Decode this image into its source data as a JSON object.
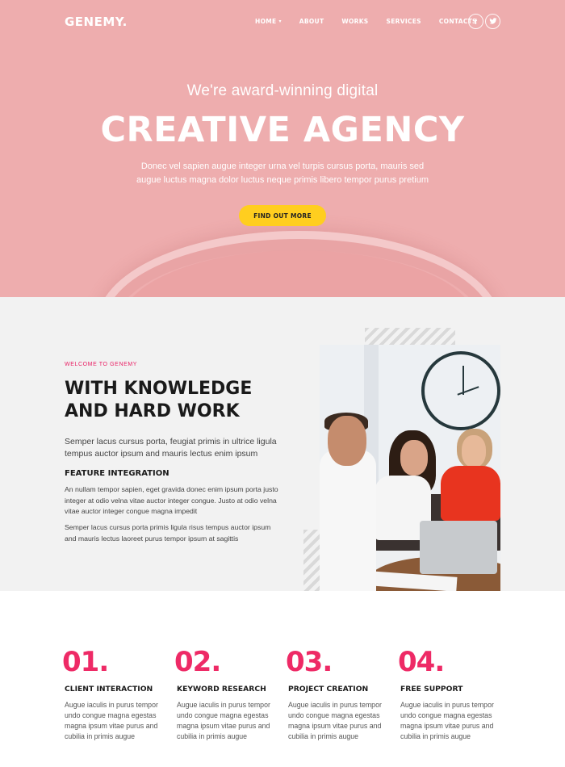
{
  "nav": {
    "logo": "GENEMY.",
    "items": [
      {
        "label": "HOME",
        "has_dropdown": true
      },
      {
        "label": "ABOUT"
      },
      {
        "label": "WORKS"
      },
      {
        "label": "SERVICES"
      },
      {
        "label": "CONTACTS"
      }
    ],
    "social": [
      {
        "icon": "facebook-icon",
        "glyph": "f"
      },
      {
        "icon": "twitter-icon",
        "glyph": "t"
      }
    ]
  },
  "hero": {
    "subtitle": "We're award-winning digital",
    "title": "CREATIVE AGENCY",
    "description": "Donec vel sapien augue integer urna vel turpis cursus porta, mauris sed augue luctus magna dolor luctus neque primis libero tempor purus pretium",
    "cta_label": "FIND OUT MORE",
    "background_color": "#eeadae",
    "cta_color": "#ffce1f"
  },
  "about": {
    "eyebrow": "WELCOME TO GENEMY",
    "title": "WITH KNOWLEDGE AND HARD WORK",
    "lead": "Semper lacus cursus porta, feugiat primis in ultrice ligula tempus auctor ipsum and mauris lectus enim ipsum",
    "feature_heading": "FEATURE INTEGRATION",
    "feature_text": "An nullam tempor sapien, eget gravida donec enim ipsum porta justo integer at odio velna vitae auctor integer congue. Justo at odio velna vitae auctor integer congue magna impedit",
    "feature_text_2": "Semper lacus cursus porta primis ligula risus tempus auctor ipsum and mauris lectus laoreet purus tempor ipsum at sagittis",
    "accent_color": "#e91e63"
  },
  "features": [
    {
      "number": "01.",
      "title": "CLIENT INTERACTION",
      "text": "Augue iaculis in purus tempor undo congue magna egestas magna ipsum vitae purus and cubilia in primis augue"
    },
    {
      "number": "02.",
      "title": "KEYWORD RESEARCH",
      "text": "Augue iaculis in purus tempor undo congue magna egestas magna ipsum vitae purus and cubilia in primis augue"
    },
    {
      "number": "03.",
      "title": "PROJECT CREATION",
      "text": "Augue iaculis in purus tempor undo congue magna egestas magna ipsum vitae purus and cubilia in primis augue"
    },
    {
      "number": "04.",
      "title": "FREE SUPPORT",
      "text": "Augue iaculis in purus tempor undo congue magna egestas magna ipsum vitae purus and cubilia in primis augue"
    }
  ],
  "feature_number_color": "#ee2a66"
}
